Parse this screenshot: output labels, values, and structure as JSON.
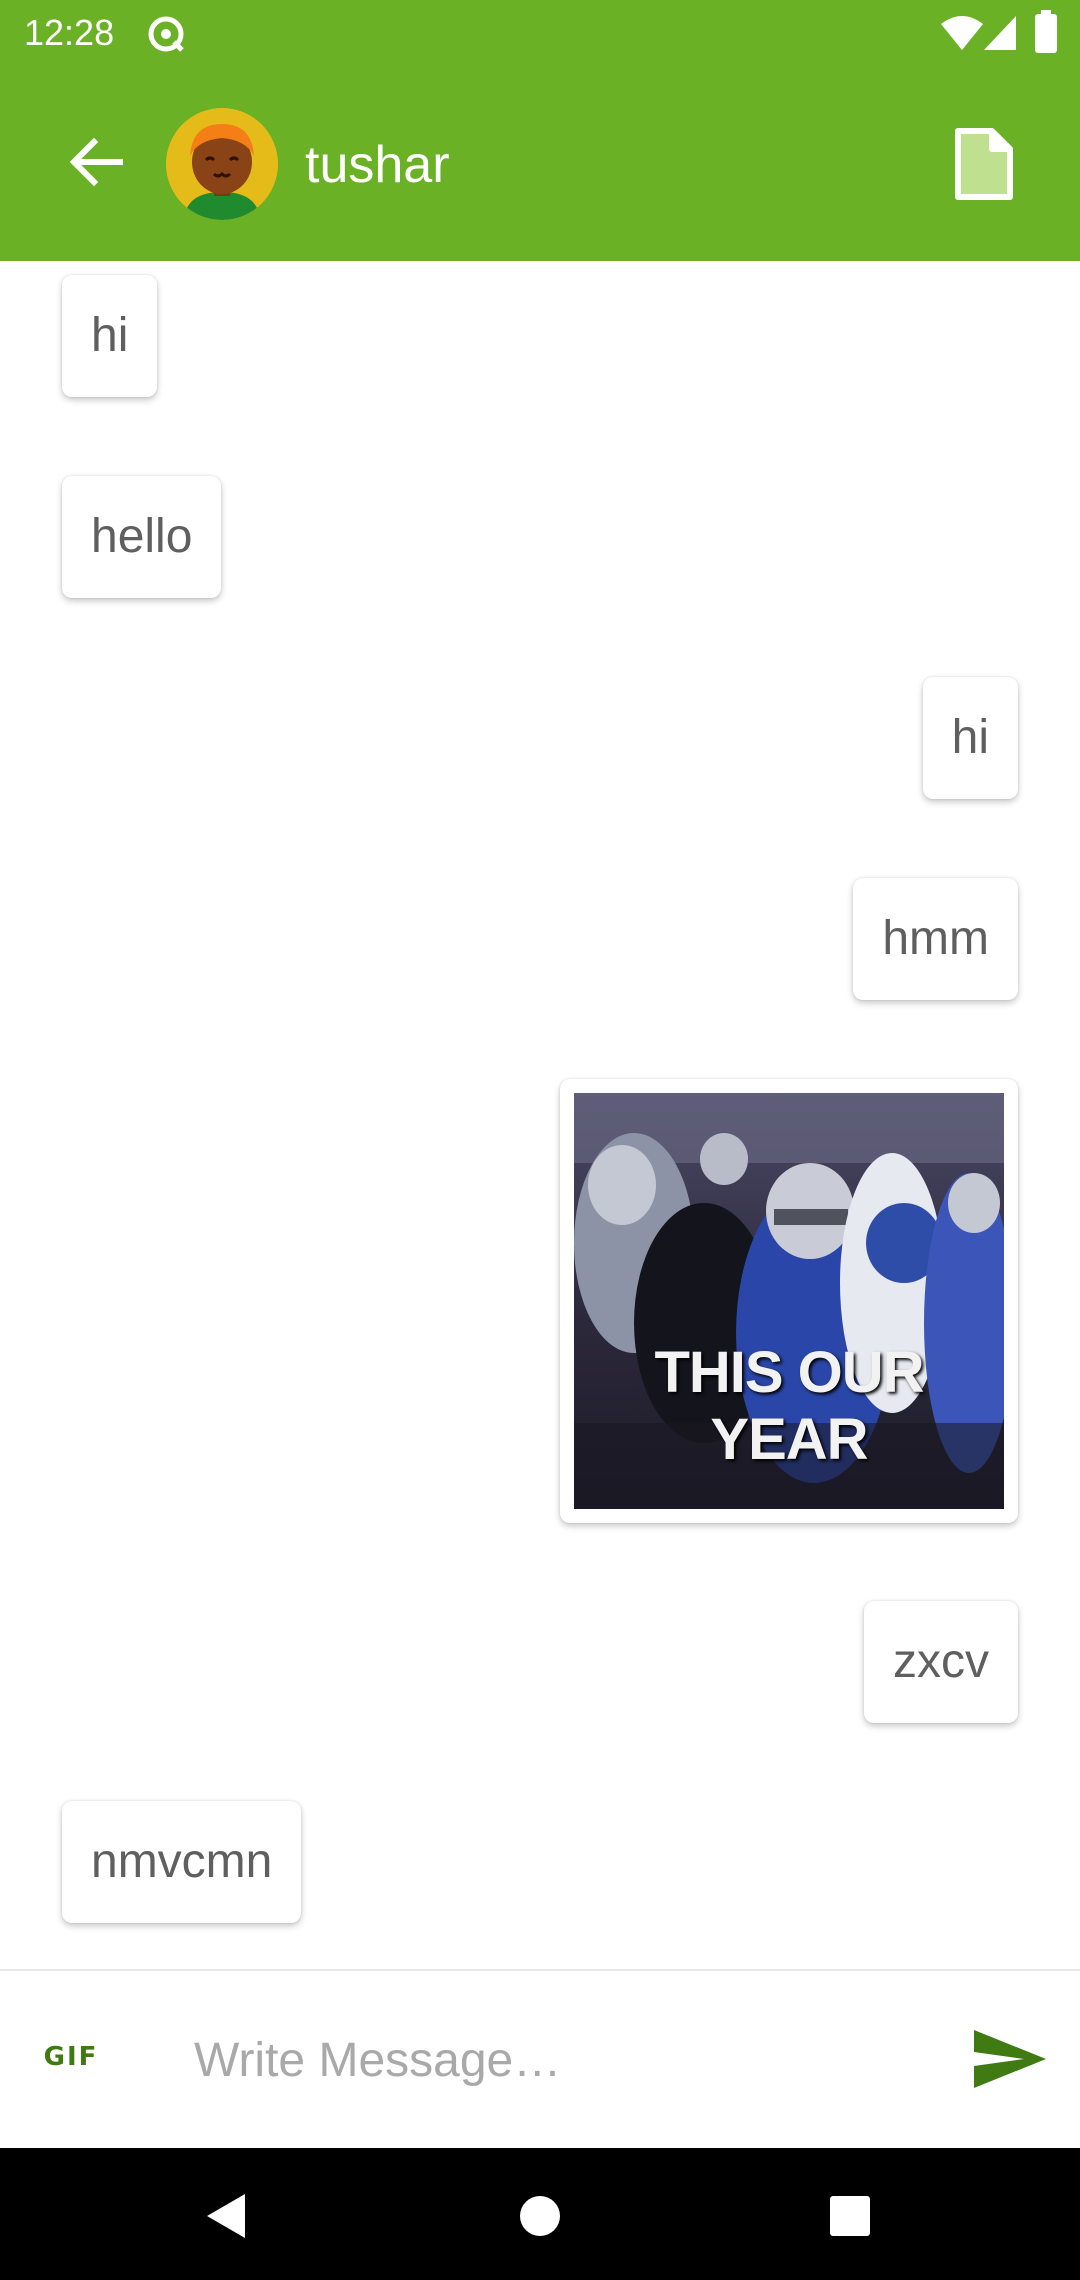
{
  "status_bar": {
    "time": "12:28",
    "icons": [
      "notification-at-icon",
      "wifi-icon",
      "signal-icon",
      "battery-icon"
    ]
  },
  "app_bar": {
    "contact_name": "tushar",
    "background_color": "#6ab125",
    "back_icon": "arrow-back-icon",
    "action_icon": "file-icon"
  },
  "messages": [
    {
      "side": "left",
      "type": "text",
      "text": "hi"
    },
    {
      "side": "left",
      "type": "text",
      "text": "hello"
    },
    {
      "side": "right",
      "type": "text",
      "text": "hi"
    },
    {
      "side": "right",
      "type": "text",
      "text": "hmm"
    },
    {
      "side": "right",
      "type": "gif",
      "caption": "THIS OUR YEAR"
    },
    {
      "side": "right",
      "type": "text",
      "text": "zxcv"
    },
    {
      "side": "left",
      "type": "text",
      "text": "nmvcmn"
    }
  ],
  "composer": {
    "gif_label": "GIF",
    "placeholder": "Write Message…",
    "value": "",
    "send_icon": "send-icon",
    "accent_color": "#3f7a12"
  },
  "nav_bar": {
    "buttons": [
      "back-triangle-icon",
      "home-circle-icon",
      "recents-square-icon"
    ]
  }
}
